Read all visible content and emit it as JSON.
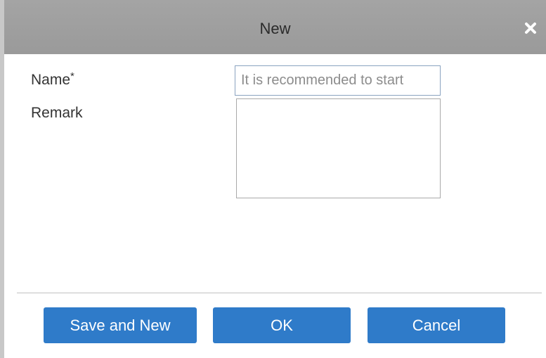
{
  "dialog": {
    "title": "New",
    "close_icon": "close-icon"
  },
  "form": {
    "name_label": "Name",
    "required_mark": "*",
    "name_placeholder": "It is recommended to start",
    "name_value": "",
    "remark_label": "Remark",
    "remark_value": ""
  },
  "buttons": {
    "save_and_new": "Save and New",
    "ok": "OK",
    "cancel": "Cancel"
  },
  "colors": {
    "titlebar": "#9e9e9e",
    "button": "#2f7bc9",
    "input_border": "#8aa3c0"
  }
}
